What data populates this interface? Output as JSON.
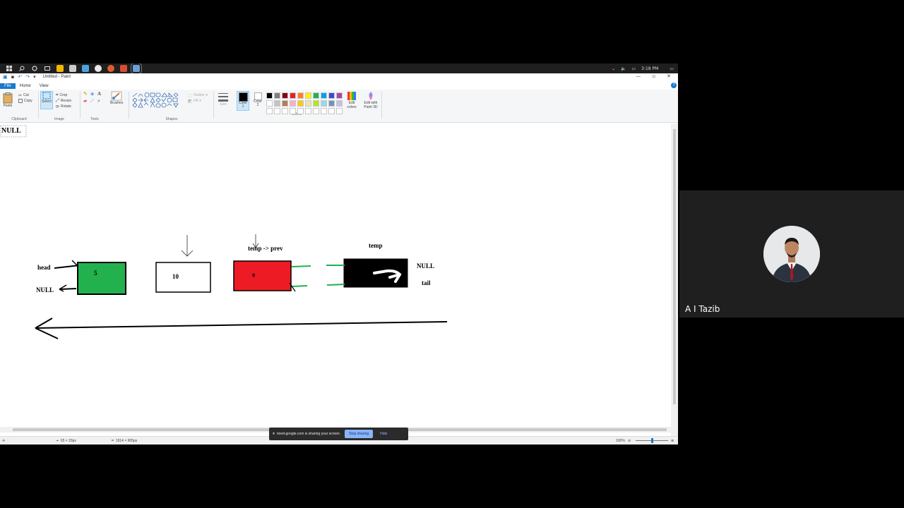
{
  "taskbar": {
    "start_icon": "windows-logo-icon",
    "search_icon": "search-icon",
    "cortana_icon": "circle-icon",
    "taskview_icon": "task-view-icon",
    "time": "3:18 PM",
    "tray_icons": [
      "chevron-up-icon",
      "volume-icon",
      "network-icon"
    ]
  },
  "window": {
    "title": "Untitled - Paint",
    "controls": [
      "minimize",
      "maximize",
      "close"
    ]
  },
  "ribbon": {
    "tabs": [
      "File",
      "Home",
      "View"
    ],
    "clipboard": {
      "paste": "Paste",
      "cut": "Cut",
      "copy": "Copy",
      "label": "Clipboard"
    },
    "image": {
      "select": "Select",
      "crop": "Crop",
      "resize": "Resize",
      "rotate": "Rotate",
      "label": "Image"
    },
    "tools": {
      "label": "Tools"
    },
    "brushes": {
      "label": "Brushes"
    },
    "shapes": {
      "outline": "Outline",
      "fill": "Fill",
      "label": "Shapes"
    },
    "size": {
      "label": "Size"
    },
    "color1": {
      "label": "Color 1"
    },
    "color2": {
      "label": "Color 2"
    },
    "colors": {
      "label": "Colors"
    },
    "edit_colors": "Edit colors",
    "edit_3d": "Edit with Paint 3D",
    "palette": [
      "#000000",
      "#7f7f7f",
      "#880015",
      "#ed1c24",
      "#ff7f27",
      "#fff200",
      "#22b14c",
      "#00a2e8",
      "#3f48cc",
      "#a349a4",
      "#ffffff",
      "#c3c3c3",
      "#b97a57",
      "#ffaec9",
      "#ffc90e",
      "#efe4b0",
      "#b5e61d",
      "#99d9ea",
      "#7092be",
      "#c8bfe7",
      "#ffffff",
      "#ffffff",
      "#ffffff",
      "#ffffff",
      "#ffffff",
      "#ffffff",
      "#ffffff",
      "#ffffff",
      "#ffffff",
      "#ffffff"
    ]
  },
  "canvas": {
    "top_left_text": "NULL",
    "labels": {
      "head": "head",
      "null_left": "NULL",
      "temp_prev": "temp -> prev",
      "temp": "temp",
      "null_right": "NULL",
      "tail": "tail"
    },
    "nodes": [
      {
        "value": "5",
        "fill": "#22b14c"
      },
      {
        "value": "10",
        "fill": "#ffffff"
      },
      {
        "value": "9",
        "fill": "#ed1c24"
      },
      {
        "value": "",
        "fill": "#000000"
      }
    ],
    "connector_color": "#22b14c"
  },
  "statusbar": {
    "cursor_pos": "65 × 33px",
    "canvas_size": "1914 × 905px",
    "zoom": "100%"
  },
  "share_banner": {
    "message": "meet.google.com is sharing your screen.",
    "stop": "Stop sharing",
    "hide": "Hide"
  },
  "participant": {
    "name": "A I Tazib"
  }
}
